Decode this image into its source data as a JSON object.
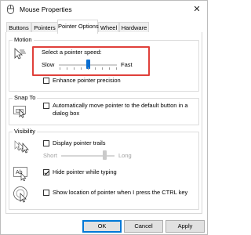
{
  "window": {
    "title": "Mouse Properties",
    "close_glyph": "✕"
  },
  "tabs": [
    "Buttons",
    "Pointers",
    "Pointer Options",
    "Wheel",
    "Hardware"
  ],
  "active_tab": "Pointer Options",
  "motion": {
    "group_label": "Motion",
    "speed_label": "Select a pointer speed:",
    "slow_label": "Slow",
    "fast_label": "Fast",
    "speed_level": 0.5,
    "precision_label": "Enhance pointer precision",
    "precision_checked": false
  },
  "snap_to": {
    "group_label": "Snap To",
    "checkbox_line1": "Automatically move pointer to the default button in a",
    "checkbox_line2": "dialog box",
    "checked": false
  },
  "visibility": {
    "group_label": "Visibility",
    "trails_label": "Display pointer trails",
    "trails_checked": false,
    "short_label": "Short",
    "long_label": "Long",
    "hide_label": "Hide pointer while typing",
    "hide_checked": true,
    "ctrl_label": "Show location of pointer when I press the CTRL key",
    "ctrl_checked": false
  },
  "buttons": {
    "ok": "OK",
    "cancel": "Cancel",
    "apply": "Apply"
  },
  "colors": {
    "accent": "#0a6fd1",
    "highlight": "#e0403a"
  }
}
